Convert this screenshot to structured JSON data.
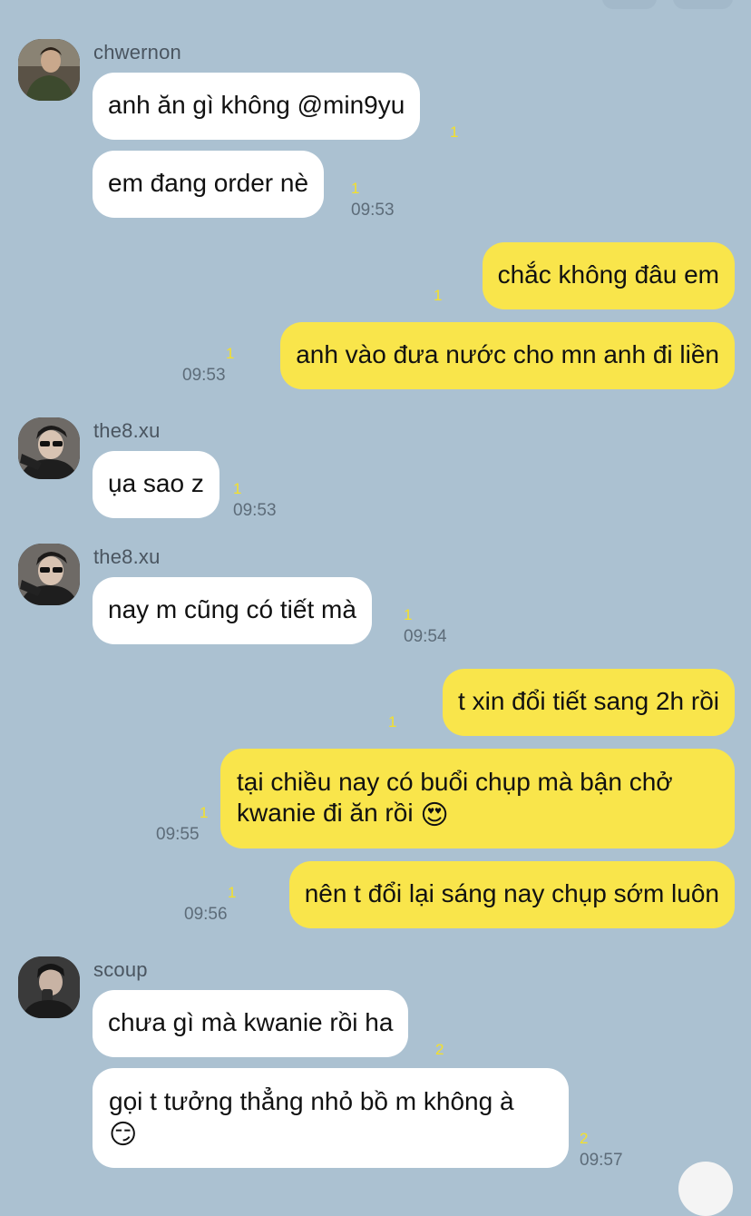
{
  "messages": [
    {
      "sender": "chwernon",
      "text": "anh ăn gì không @min9yu",
      "unread": "1"
    },
    {
      "text": "em đang order nè",
      "unread": "1",
      "time": "09:53"
    },
    {
      "text": "chắc không đâu em",
      "unread": "1"
    },
    {
      "text": "anh vào đưa nước cho mn anh đi liền",
      "unread": "1",
      "time": "09:53"
    },
    {
      "sender": "the8.xu",
      "text": "ụa sao z",
      "unread": "1",
      "time": "09:53"
    },
    {
      "sender": "the8.xu",
      "text": "nay m cũng có tiết mà",
      "unread": "1",
      "time": "09:54"
    },
    {
      "text": "t xin đổi tiết sang 2h rồi",
      "unread": "1"
    },
    {
      "text_line1": "tại chiều nay có buổi chụp mà bận chở",
      "text_line2": "kwanie đi ăn rồi",
      "emoji": "😍",
      "unread": "1",
      "time": "09:55"
    },
    {
      "text": "nên t đổi lại sáng nay chụp sớm luôn",
      "unread": "1",
      "time": "09:56"
    },
    {
      "sender": "scoup",
      "text": "chưa gì mà kwanie rồi ha",
      "unread": "2"
    },
    {
      "text_line1": "gọi t tưởng thẳng nhỏ bồ m không à",
      "emoji": "😏",
      "unread": "2",
      "time": "09:57"
    }
  ],
  "colors": {
    "background": "#abc1d1",
    "incoming_bubble": "#ffffff",
    "outgoing_bubble": "#f9e54b",
    "unread_count": "#f4e02a"
  }
}
